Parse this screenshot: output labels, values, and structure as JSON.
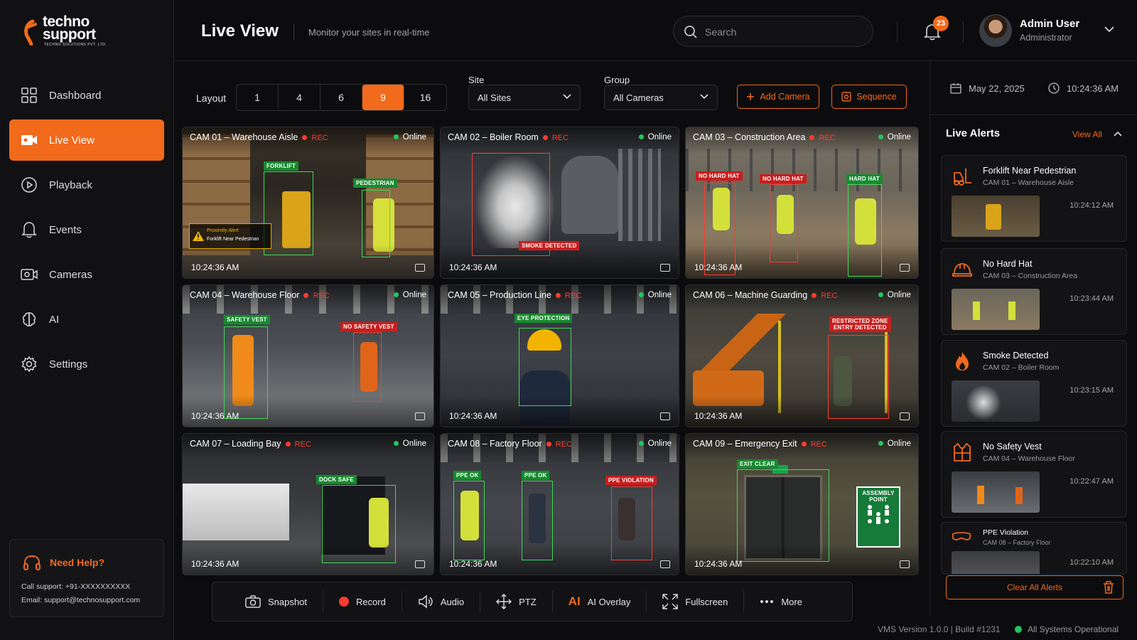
{
  "brand": {
    "line1": "techno",
    "line2": "support",
    "tagline": "TECHNO SOLUTIONS PVT. LTD.",
    "accent": "#f26a1b"
  },
  "sidebar": {
    "items": [
      {
        "label": "Dashboard",
        "icon": "grid-icon"
      },
      {
        "label": "Live View",
        "icon": "video-camera-icon",
        "active": true
      },
      {
        "label": "Playback",
        "icon": "play-circle-icon"
      },
      {
        "label": "Events",
        "icon": "bell-icon"
      },
      {
        "label": "Cameras",
        "icon": "camera-icon"
      },
      {
        "label": "AI",
        "icon": "brain-icon"
      },
      {
        "label": "Settings",
        "icon": "gear-icon"
      }
    ]
  },
  "help": {
    "title": "Need Help?",
    "call": "Call support: +91-XXXXXXXXXX",
    "email": "Email: support@technosupport.com"
  },
  "header": {
    "title": "Live View",
    "subtitle": "Monitor your sites in real-time",
    "search_placeholder": "Search",
    "notifications": "23",
    "user_name": "Admin User",
    "user_role": "Administrator"
  },
  "controls": {
    "layout_label": "Layout",
    "layouts": [
      "1",
      "4",
      "6",
      "9",
      "16"
    ],
    "layout_selected": "9",
    "site_label": "Site",
    "site_value": "All Sites",
    "group_label": "Group",
    "group_value": "All Cameras",
    "add_camera": "Add Camera",
    "sequence": "Sequence"
  },
  "cameras": [
    {
      "name": "CAM 01 – Warehouse Aisle",
      "rec": "REC",
      "status": "Online",
      "time": "10:24:36 AM",
      "tags": [
        "FORKLIFT",
        "PEDESTRIAN"
      ],
      "alert_title": "Proximity Alert",
      "alert_text": "Forklift Near Pedestrian"
    },
    {
      "name": "CAM 02 – Boiler Room",
      "rec": "REC",
      "status": "Online",
      "time": "10:24:36 AM",
      "tags": [
        "SMOKE DETECTED"
      ]
    },
    {
      "name": "CAM 03 – Construction Area",
      "rec": "REC",
      "status": "Online",
      "time": "10:24:36 AM",
      "tags": [
        "NO HARD HAT",
        "NO HARD HAT",
        "HARD HAT"
      ]
    },
    {
      "name": "CAM 04 –  Warehouse Floor",
      "rec": "REC",
      "status": "Online",
      "time": "10:24:36 AM",
      "tags": [
        "SAFETY VEST",
        "NO SAFETY VEST"
      ]
    },
    {
      "name": "CAM 05 – Production Line",
      "rec": "REC",
      "status": "Online",
      "time": "10:24:36 AM",
      "tags": [
        "EYE PROTECTION"
      ]
    },
    {
      "name": "CAM 06 – Machine Guarding",
      "rec": "REC",
      "status": "Online",
      "time": "10:24:36 AM",
      "tags": [
        "RESTRICTED ZONE",
        "ENTRY DETECTED"
      ]
    },
    {
      "name": "CAM 07 –  Loading Bay",
      "rec": "REC",
      "status": "Online",
      "time": "10:24:36 AM",
      "tags": [
        "DOCK SAFE"
      ]
    },
    {
      "name": "CAM 08 – Factory Floor",
      "rec": "REC",
      "status": "Online",
      "time": "10:24:36 AM",
      "tags": [
        "PPE OK",
        "PPE OK",
        "PPE VIOLATION"
      ]
    },
    {
      "name": "CAM 09 – Emergency Exit",
      "rec": "REC",
      "status": "Online",
      "time": "10:24:36 AM",
      "tags": [
        "EXIT CLEAR",
        "ASSEMBLY",
        "POINT"
      ]
    }
  ],
  "toolbar": [
    "Snapshot",
    "Record",
    "Audio",
    "PTZ",
    "AI Overlay",
    "Fullscreen",
    "More"
  ],
  "toolbar_ai_glyph": "AI",
  "footer": {
    "version": "VMS Version 1.0.0 | Build #1231",
    "status": "All Systems Operational"
  },
  "right": {
    "date": "May 22, 2025",
    "time": "10:24:36 AM",
    "alerts_title": "Live Alerts",
    "view_all": "View All",
    "clear": "Clear All Alerts",
    "alerts": [
      {
        "title": "Forklift Near Pedestrian",
        "sub": "CAM 01 – Warehouse Aisle",
        "time": "10:24:12 AM",
        "icon": "forklift-icon"
      },
      {
        "title": "No Hard Hat",
        "sub": "CAM 03 – Construction Area",
        "time": "10:23:44 AM",
        "icon": "hard-hat-icon"
      },
      {
        "title": "Smoke Detected",
        "sub": "CAM 02 – Boiler Room",
        "time": "10:23:15 AM",
        "icon": "flame-icon"
      },
      {
        "title": "No Safety Vest",
        "sub": "CAM 04 – Warehouse Floor",
        "time": "10:22:47 AM",
        "icon": "vest-icon"
      },
      {
        "title": "PPE Violation",
        "sub": "CAM 08 – Factory Floor",
        "time": "10:22:10 AM",
        "icon": "goggles-icon"
      }
    ]
  }
}
